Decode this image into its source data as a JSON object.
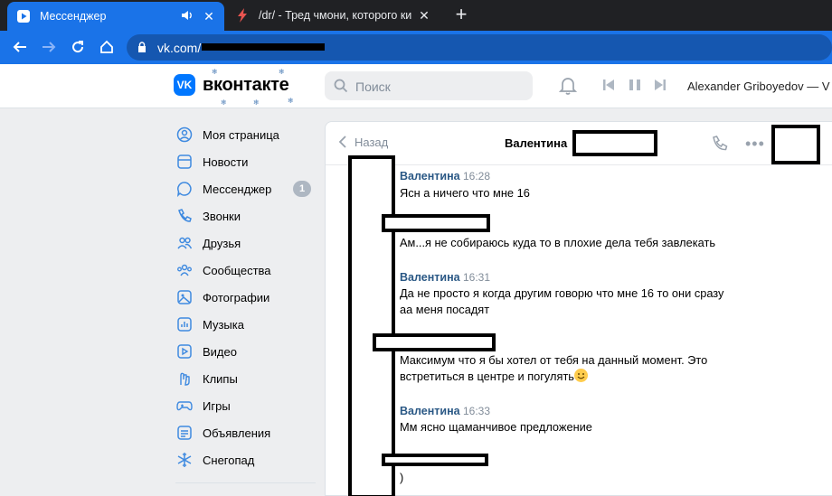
{
  "browser": {
    "tabs": [
      {
        "title": "Мессенджер",
        "active": true
      },
      {
        "title": "/dr/ - Тред чмони, которого ки",
        "active": false
      }
    ],
    "url": "vk.com/"
  },
  "vk": {
    "logo_text": "вконтакте",
    "search_placeholder": "Поиск",
    "user_name": "Alexander Griboyedov — V"
  },
  "menu": {
    "items": [
      {
        "label": "Моя страница",
        "icon": "user-circle-icon"
      },
      {
        "label": "Новости",
        "icon": "news-icon"
      },
      {
        "label": "Мессенджер",
        "icon": "message-icon",
        "badge": "1"
      },
      {
        "label": "Звонки",
        "icon": "phone-icon"
      },
      {
        "label": "Друзья",
        "icon": "friends-icon"
      },
      {
        "label": "Сообщества",
        "icon": "groups-icon"
      },
      {
        "label": "Фотографии",
        "icon": "photo-icon"
      },
      {
        "label": "Музыка",
        "icon": "music-icon"
      },
      {
        "label": "Видео",
        "icon": "video-icon"
      },
      {
        "label": "Клипы",
        "icon": "clips-icon"
      },
      {
        "label": "Игры",
        "icon": "gamepad-icon"
      },
      {
        "label": "Объявления",
        "icon": "ads-icon"
      },
      {
        "label": "Снегопад",
        "icon": "snowflake-icon"
      }
    ]
  },
  "chat": {
    "back_label": "Назад",
    "contact_name": "Валентина",
    "messages": [
      {
        "author": "Валентина",
        "time": "16:28",
        "lines": [
          "Ясн а ничего что мне 16"
        ]
      },
      {
        "author": "",
        "time": "",
        "lines": [
          "Ам...я не собираюсь куда то в плохие дела тебя завлекать"
        ]
      },
      {
        "author": "Валентина",
        "time": "16:31",
        "lines": [
          "Да не просто я когда другим говорю что мне 16 то они сразу",
          "аа меня посадят"
        ]
      },
      {
        "author": "",
        "time": "",
        "lines": [
          "Максимум что я бы хотел от тебя на данный момент. Это",
          "встретиться в центре и погулять"
        ]
      },
      {
        "author": "Валентина",
        "time": "16:33",
        "lines": [
          "Мм ясно щаманчивое предложение"
        ]
      },
      {
        "author": "",
        "time": "",
        "lines": [
          ")"
        ]
      }
    ]
  },
  "colors": {
    "vk_blue": "#0077ff",
    "link": "#2a5885",
    "chrome_blue": "#1a73e8"
  }
}
